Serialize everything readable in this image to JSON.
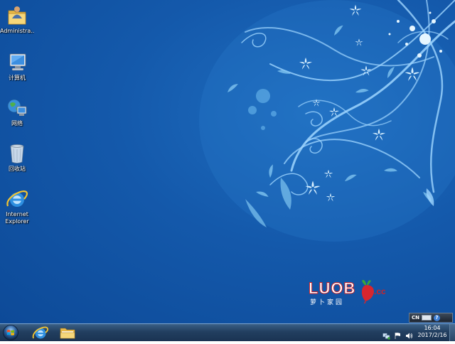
{
  "desktop": {
    "icons": [
      {
        "label": "Administra...",
        "icon": "user-folder-icon"
      },
      {
        "label": "计算机",
        "icon": "computer-icon"
      },
      {
        "label": "网络",
        "icon": "network-icon"
      },
      {
        "label": "回收站",
        "icon": "recycle-bin-icon"
      },
      {
        "label": "Internet\nExplorer",
        "icon": "internet-explorer-icon"
      }
    ]
  },
  "wallpaper": {
    "brand": "LUOB",
    "brand_suffix": ".cc",
    "brand_subtitle": "萝卜家园",
    "colors": {
      "background": "#1459ab",
      "accent": "#c8252c",
      "pattern": "#bfe6ff"
    }
  },
  "language_bar": {
    "code": "CN",
    "help": "?"
  },
  "taskbar": {
    "start": "start-orb-icon",
    "pinned": [
      "internet-explorer-icon",
      "windows-explorer-icon"
    ],
    "tray": [
      "network-tray-icon",
      "flag-tray-icon",
      "volume-tray-icon"
    ]
  },
  "clock": {
    "time": "16:04",
    "date": "2017/2/16"
  }
}
